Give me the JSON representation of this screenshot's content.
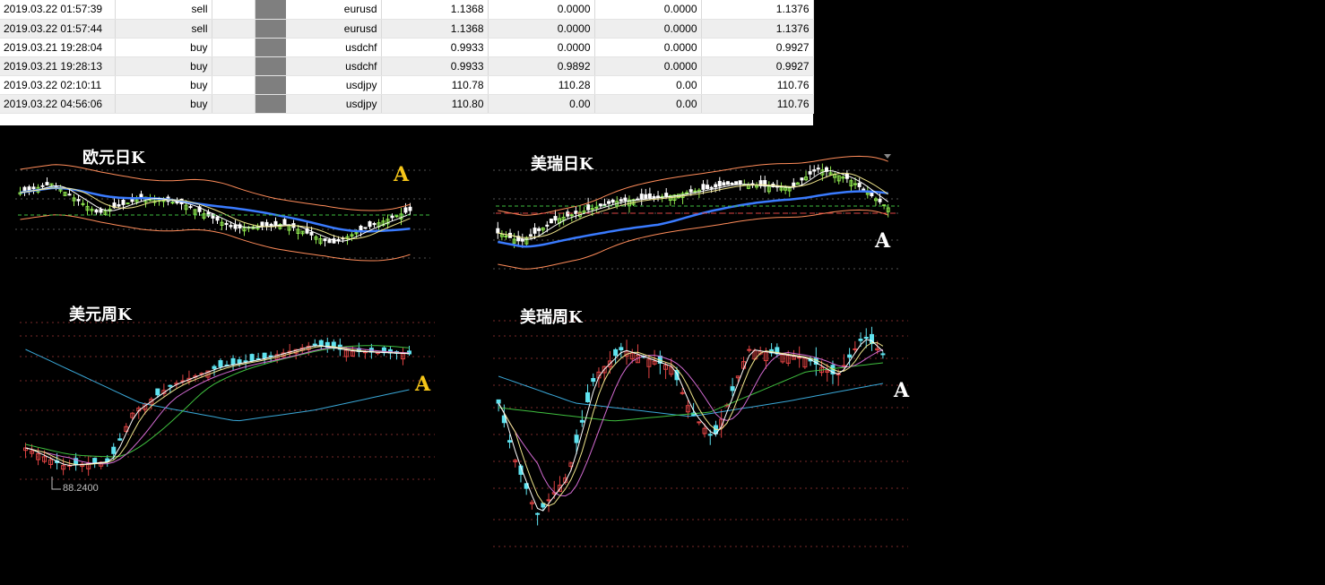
{
  "trades": [
    {
      "time": "2019.03.22 01:57:39",
      "type": "sell",
      "symbol": "eurusd",
      "price": "1.1368",
      "sl": "0.0000",
      "tp": "0.0000",
      "current": "1.1376"
    },
    {
      "time": "2019.03.22 01:57:44",
      "type": "sell",
      "symbol": "eurusd",
      "price": "1.1368",
      "sl": "0.0000",
      "tp": "0.0000",
      "current": "1.1376"
    },
    {
      "time": "2019.03.21 19:28:04",
      "type": "buy",
      "symbol": "usdchf",
      "price": "0.9933",
      "sl": "0.0000",
      "tp": "0.0000",
      "current": "0.9927"
    },
    {
      "time": "2019.03.21 19:28:13",
      "type": "buy",
      "symbol": "usdchf",
      "price": "0.9933",
      "sl": "0.9892",
      "tp": "0.0000",
      "current": "0.9927"
    },
    {
      "time": "2019.03.22 02:10:11",
      "type": "buy",
      "symbol": "usdjpy",
      "price": "110.78",
      "sl": "110.28",
      "tp": "0.00",
      "current": "110.76"
    },
    {
      "time": "2019.03.22 04:56:06",
      "type": "buy",
      "symbol": "usdjpy",
      "price": "110.80",
      "sl": "0.00",
      "tp": "0.00",
      "current": "110.76"
    }
  ],
  "charts": {
    "eur_daily": {
      "title": "欧元日K",
      "label": "A",
      "label_color": "#f5c518",
      "up": "#8ee64e",
      "down": "#ffffff"
    },
    "chf_daily": {
      "title": "美瑞日K",
      "label": "A",
      "label_color": "#ffffff",
      "up": "#8ee64e",
      "down": "#ffffff"
    },
    "usd_weekly": {
      "title": "美元周K",
      "label": "A",
      "label_color": "#f5c518",
      "min_label": "88.2400",
      "up": "#e04343",
      "down": "#5fe3f0"
    },
    "chf_weekly": {
      "title": "美瑞周K",
      "label": "A",
      "label_color": "#ffffff",
      "up": "#e04343",
      "down": "#5fe3f0"
    }
  }
}
